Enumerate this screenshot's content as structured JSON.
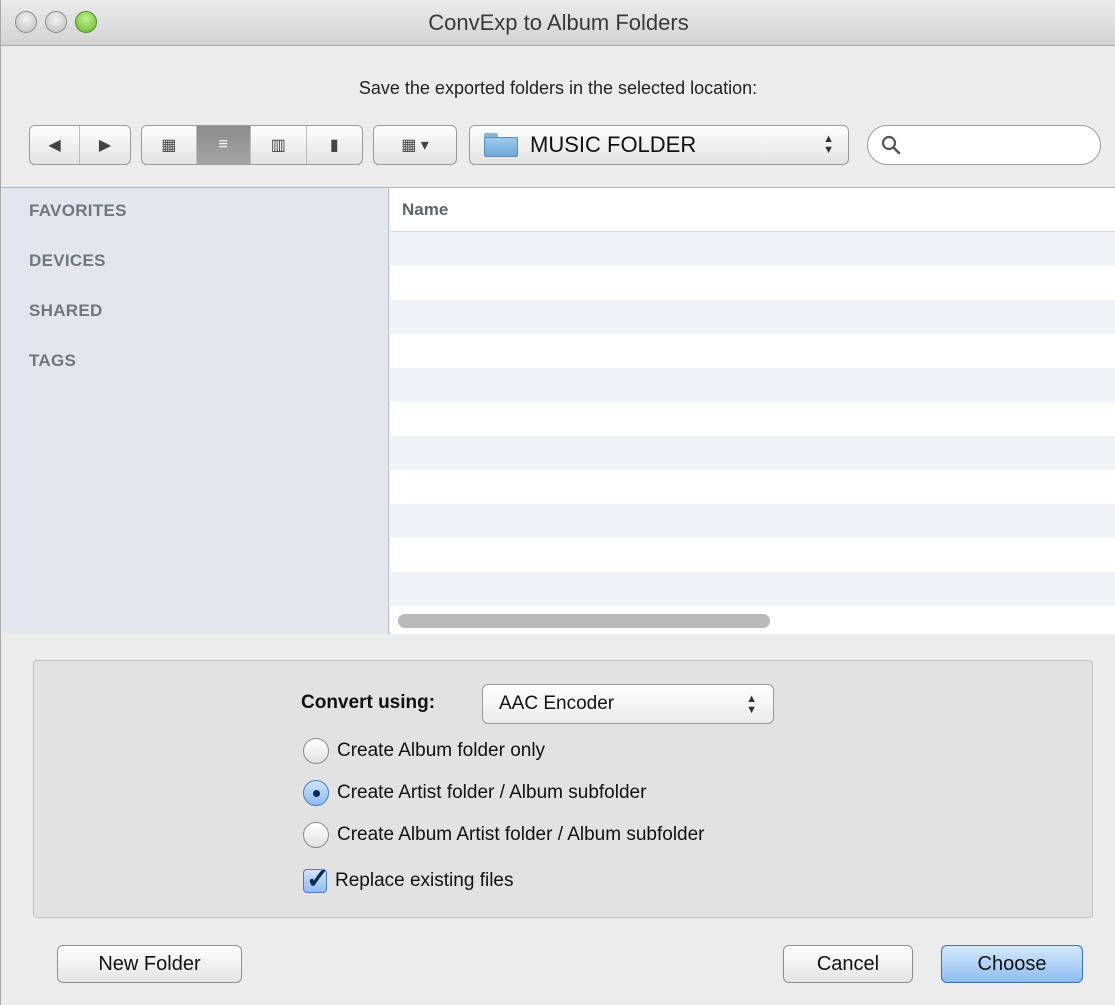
{
  "window": {
    "title": "ConvExp to Album Folders"
  },
  "prompt": "Save the exported folders in the selected location:",
  "toolbar": {
    "back_icon": "◀",
    "forward_icon": "▶",
    "view_icons": "▦",
    "view_list": "≡",
    "view_columns": "▥",
    "view_coverflow": "▮",
    "arrange_icon": "▦ ▾",
    "location": "MUSIC FOLDER",
    "search_placeholder": ""
  },
  "sidebar": {
    "items": [
      {
        "label": "FAVORITES"
      },
      {
        "label": "DEVICES"
      },
      {
        "label": "SHARED"
      },
      {
        "label": "TAGS"
      }
    ]
  },
  "list": {
    "header": "Name"
  },
  "options": {
    "convert_label": "Convert using:",
    "encoder": "AAC Encoder",
    "radios": [
      {
        "label": "Create Album folder only",
        "selected": false
      },
      {
        "label": "Create Artist folder / Album subfolder",
        "selected": true
      },
      {
        "label": "Create Album Artist folder / Album subfolder",
        "selected": false
      }
    ],
    "replace_label": "Replace existing files",
    "replace_checked": true
  },
  "buttons": {
    "new_folder": "New Folder",
    "cancel": "Cancel",
    "choose": "Choose"
  },
  "colors": {
    "accent": "#8cbdf0",
    "sidebar_bg": "#e3e7ed",
    "row_alt": "#f0f3f8"
  }
}
